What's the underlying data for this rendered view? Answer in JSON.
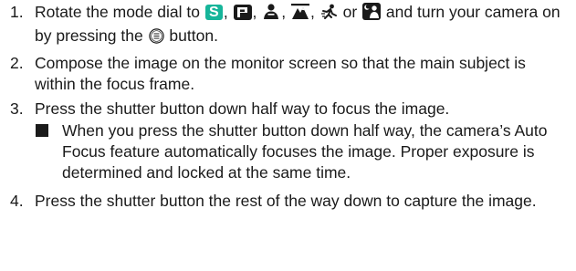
{
  "steps": [
    {
      "num": "1.",
      "text_a": "Rotate the mode dial to ",
      "sep1": ", ",
      "sep2": ", ",
      "sep3": ", ",
      "sep4": ", ",
      "sep5": " or ",
      "text_b": " and turn your camera on by pressing the ",
      "text_c": " button."
    },
    {
      "num": "2.",
      "text": "Compose the image on the monitor screen so that the main subject is within the focus frame."
    },
    {
      "num": "3.",
      "text": "Press the shutter button down half way to focus the image.",
      "note": "When you press the shutter button down half way, the camera’s Auto Focus feature automatically focuses the image. Proper exposure is determined and locked at the same time."
    },
    {
      "num": "4.",
      "text": "Press the shutter button the rest of the way down to capture the image."
    }
  ],
  "icons": {
    "mode_s_letter": "S",
    "mode_s_color": "#16b59a",
    "mode_p_color": "#1a1a1a",
    "names": [
      "mode-s-icon",
      "mode-p-icon",
      "portrait-mode-icon",
      "landscape-mode-icon",
      "sports-mode-icon",
      "night-portrait-mode-icon",
      "power-button-icon"
    ]
  }
}
